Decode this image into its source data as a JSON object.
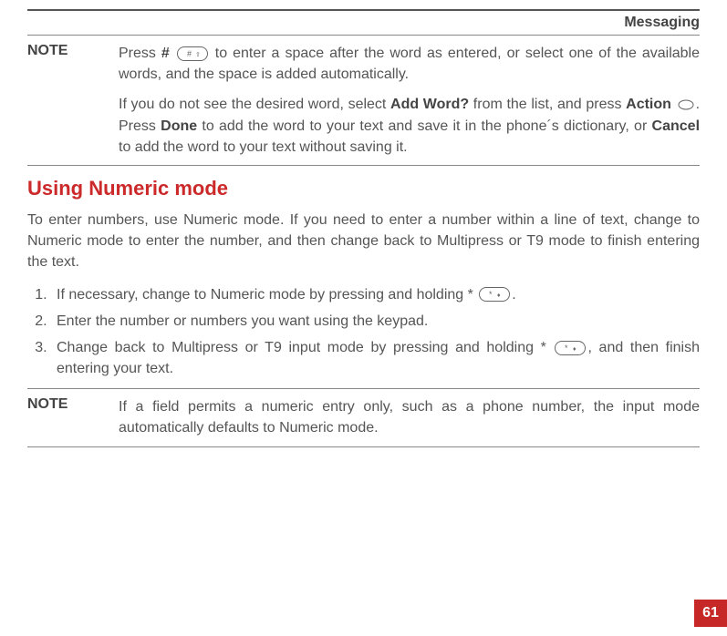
{
  "header": {
    "title": "Messaging"
  },
  "note1": {
    "label": "NOTE",
    "p1_a": "Press ",
    "p1_b": "# ",
    "p1_c": " to enter a space after the word as entered, or select one of the available words, and the space is added automatically.",
    "p2_a": "If you do not see the desired word, select ",
    "p2_b": "Add Word?",
    "p2_c": " from the list, and press ",
    "p2_d": "Action",
    "p2_e": " ",
    "p2_f": ". Press ",
    "p2_g": "Done",
    "p2_h": " to add the word to your text and save it in the phone´s dictionary, or ",
    "p2_i": "Cancel",
    "p2_j": " to add the word to your text without saving it."
  },
  "section_title": "Using Numeric mode",
  "intro": "To enter numbers, use Numeric mode. If you need to enter a number within a line of text, change to Numeric mode to enter the number, and then change back to Multipress or T9 mode to finish entering the text.",
  "steps": {
    "s1_a": "If necessary, change to Numeric mode by pressing and holding * ",
    "s1_b": ".",
    "s2": "Enter the number or numbers you want using the keypad.",
    "s3_a": "Change back to Multipress or T9 input mode by pressing and holding * ",
    "s3_b": ", and then finish entering your text."
  },
  "note2": {
    "label": "NOTE",
    "body": "If a field permits a numeric entry only, such as a phone number, the input mode automatically defaults to Numeric mode."
  },
  "page_number": "61"
}
